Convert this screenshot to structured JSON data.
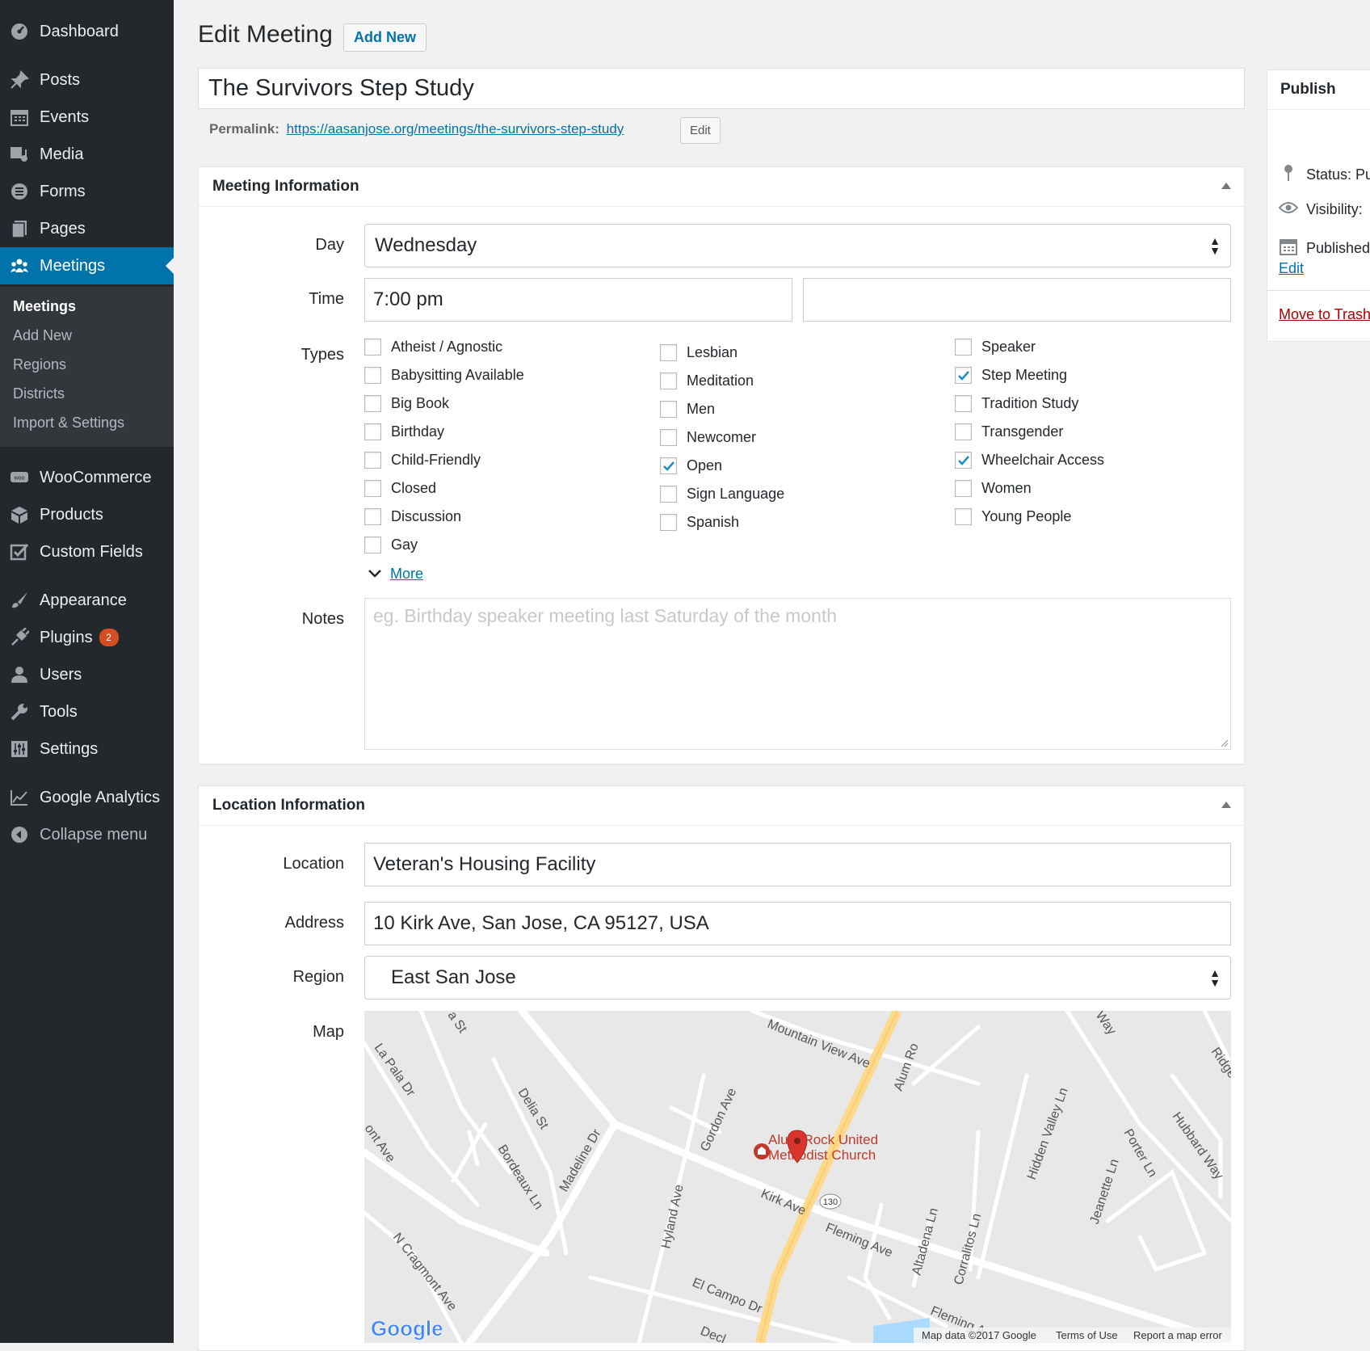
{
  "sidebar": {
    "items": [
      {
        "label": "Dashboard",
        "icon": "dashboard-icon"
      },
      {
        "label": "Posts",
        "icon": "pin-icon"
      },
      {
        "label": "Events",
        "icon": "calendar-icon"
      },
      {
        "label": "Media",
        "icon": "media-icon"
      },
      {
        "label": "Forms",
        "icon": "forms-icon"
      },
      {
        "label": "Pages",
        "icon": "pages-icon"
      },
      {
        "label": "Meetings",
        "icon": "groups-icon"
      },
      {
        "label": "WooCommerce",
        "icon": "woo-icon"
      },
      {
        "label": "Products",
        "icon": "box-icon"
      },
      {
        "label": "Custom Fields",
        "icon": "checkbox-icon"
      },
      {
        "label": "Appearance",
        "icon": "brush-icon"
      },
      {
        "label": "Plugins",
        "icon": "plugin-icon",
        "badge": "2"
      },
      {
        "label": "Users",
        "icon": "user-icon"
      },
      {
        "label": "Tools",
        "icon": "wrench-icon"
      },
      {
        "label": "Settings",
        "icon": "sliders-icon"
      },
      {
        "label": "Google Analytics",
        "icon": "chart-icon"
      },
      {
        "label": "Collapse menu",
        "icon": "collapse-icon"
      }
    ],
    "submenu": [
      "Meetings",
      "Add New",
      "Regions",
      "Districts",
      "Import & Settings"
    ]
  },
  "header": {
    "title": "Edit Meeting",
    "add_new": "Add New",
    "post_title": "The Survivors Step Study",
    "permalink_label": "Permalink:",
    "permalink_url": "https://aasanjose.org/meetings/the-survivors-step-study",
    "permalink_edit": "Edit"
  },
  "meeting_info": {
    "title": "Meeting Information",
    "day_label": "Day",
    "day_value": "Wednesday",
    "time_label": "Time",
    "time_value": "7:00 pm",
    "end_time_value": "",
    "types_label": "Types",
    "types": [
      [
        {
          "label": "Atheist / Agnostic",
          "checked": false
        },
        {
          "label": "Babysitting Available",
          "checked": false
        },
        {
          "label": "Big Book",
          "checked": false
        },
        {
          "label": "Birthday",
          "checked": false
        },
        {
          "label": "Child-Friendly",
          "checked": false
        },
        {
          "label": "Closed",
          "checked": false
        },
        {
          "label": "Discussion",
          "checked": false
        },
        {
          "label": "Gay",
          "checked": false
        }
      ],
      [
        {
          "label": "Lesbian",
          "checked": false
        },
        {
          "label": "Meditation",
          "checked": false
        },
        {
          "label": "Men",
          "checked": false
        },
        {
          "label": "Newcomer",
          "checked": false
        },
        {
          "label": "Open",
          "checked": true
        },
        {
          "label": "Sign Language",
          "checked": false
        },
        {
          "label": "Spanish",
          "checked": false
        }
      ],
      [
        {
          "label": "Speaker",
          "checked": false
        },
        {
          "label": "Step Meeting",
          "checked": true
        },
        {
          "label": "Tradition Study",
          "checked": false
        },
        {
          "label": "Transgender",
          "checked": false
        },
        {
          "label": "Wheelchair Access",
          "checked": true
        },
        {
          "label": "Women",
          "checked": false
        },
        {
          "label": "Young People",
          "checked": false
        }
      ]
    ],
    "more_label": "More",
    "notes_label": "Notes",
    "notes_placeholder": "eg. Birthday speaker meeting last Saturday of the month"
  },
  "location_info": {
    "title": "Location Information",
    "location_label": "Location",
    "location_value": "Veteran's Housing Facility",
    "address_label": "Address",
    "address_value": "10 Kirk Ave, San Jose, CA 95127, USA",
    "region_label": "Region",
    "region_value": "East San Jose",
    "map_label": "Map"
  },
  "publish": {
    "title": "Publish",
    "status": "Status: Pu",
    "visibility": "Visibility:",
    "published": "Published",
    "edit_link": "Edit",
    "trash_link": "Move to Trash"
  },
  "map": {
    "streets": [
      "Mountain View Ave",
      "Alum Ro",
      "La Pala Dr",
      "a St",
      "Delia St",
      "Gordon Ave",
      "ont Ave",
      "Bordeaux Ln",
      "Madeline Dr",
      "Hyland Ave",
      "Kirk Ave",
      "Fleming Ave",
      "Altadena Ln",
      "Corralitos Ln",
      "Hidden Valley Ln",
      "Porter Ln",
      "Jeanette Ln",
      "Hubbard Way",
      "Way",
      "Ridge",
      "N Cragmont Ave",
      "El Campo Dr",
      "Decl",
      "Fleming A"
    ],
    "route": "130",
    "poi_line1": "Alum Rock United",
    "poi_line2": "Methodist Church",
    "logo": "Google",
    "footer_data": "Map data ©2017 Google",
    "footer_terms": "Terms of Use",
    "footer_report": "Report a map error",
    "colors": {
      "road": "#ffffff",
      "highway": "#fdd989",
      "land": "#e8e8e8",
      "pin": "#d9352c",
      "poi": "#c0392b"
    }
  }
}
